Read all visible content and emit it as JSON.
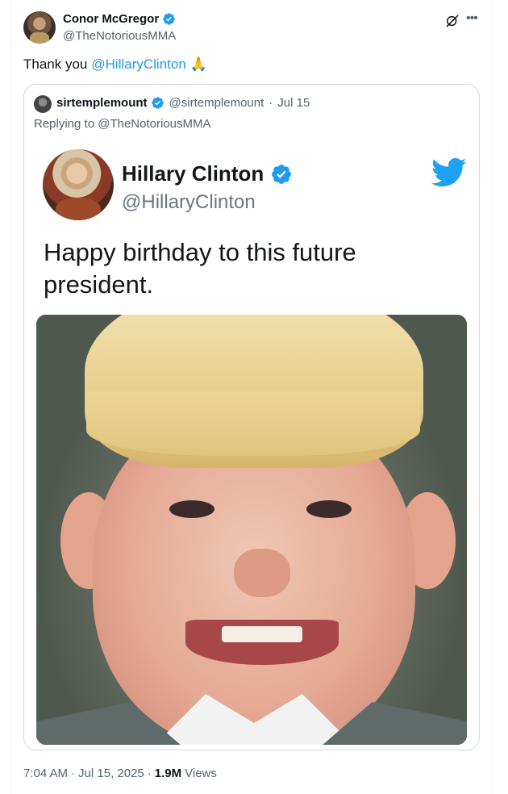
{
  "post": {
    "author": {
      "display_name": "Conor McGregor",
      "handle": "@TheNotoriousMMA",
      "verified": true,
      "avatar_icon": "user-avatar-photo"
    },
    "text_prefix": "Thank you",
    "mention": "@HillaryClinton",
    "emoji": "🙏",
    "time": "7:04 AM",
    "separator": "·",
    "date": "Jul 15, 2025",
    "views_count": "1.9M",
    "views_label": "Views"
  },
  "quote": {
    "display_name": "sirtemplemount",
    "handle": "@sirtemplemount",
    "separator": "·",
    "date": "Jul 15",
    "replying_to": "Replying to @TheNotoriousMMA",
    "verified": true
  },
  "embedded_screenshot": {
    "display_name": "Hillary Clinton",
    "handle": "@HillaryClinton",
    "text": "Happy birthday to this future president.",
    "verified": true,
    "platform_icon": "twitter-bird-icon"
  },
  "colors": {
    "link": "#1d9bf0",
    "verified": "#1d9bf0",
    "secondary_text": "#536471",
    "border": "#cfd9de"
  }
}
